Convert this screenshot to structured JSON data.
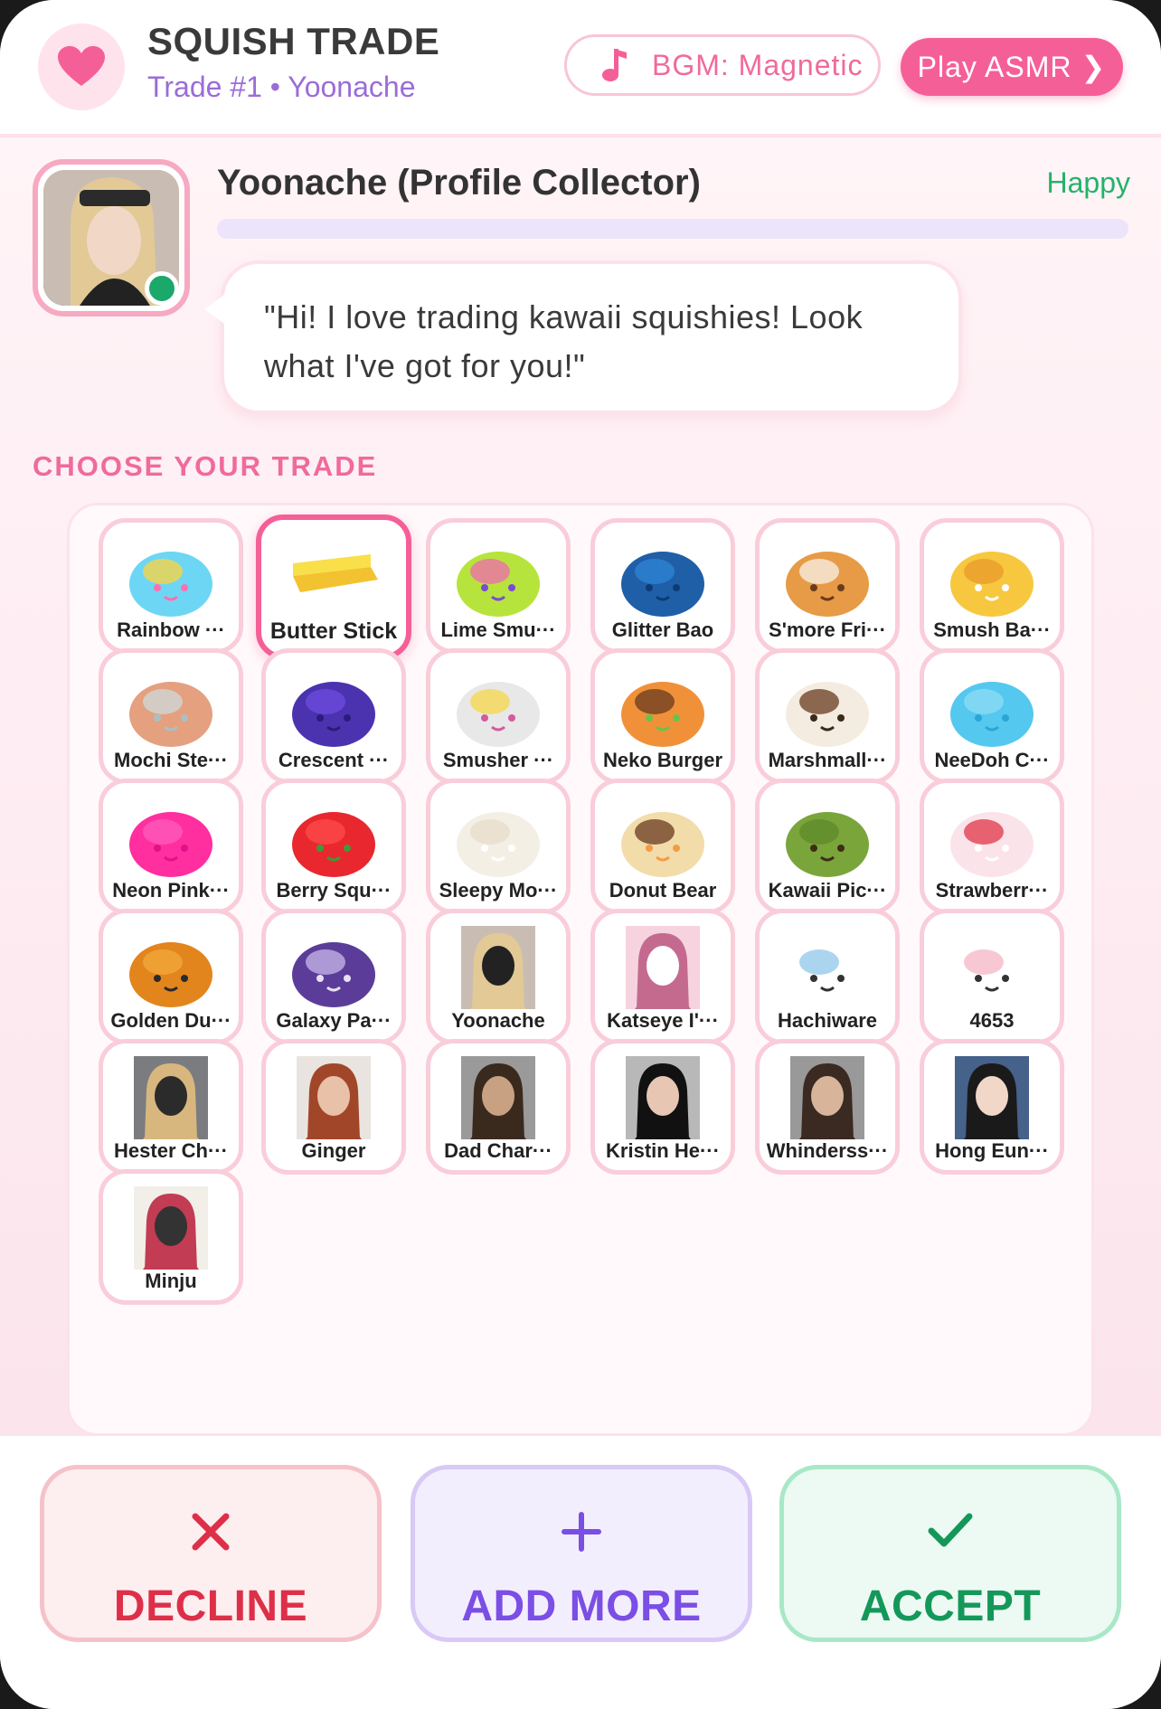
{
  "header": {
    "title": "SQUISH TRADE",
    "subtitle": "Trade #1 • Yoonache",
    "bgm_label": "BGM: Magnetic",
    "asmr_label": "Play ASMR",
    "asmr_chevron": "❯",
    "accent": "#f55f97"
  },
  "npc": {
    "name": "Yoonache (Profile Collector)",
    "mood": "Happy",
    "message": "\"Hi! I love trading kawaii squishies! Look what I've got for you!\"",
    "status": "online"
  },
  "choose_label": "CHOOSE YOUR TRADE",
  "items": [
    {
      "label": "Rainbow ···",
      "icon": "rainbow-bun-icon"
    },
    {
      "label": "Butter Stick",
      "icon": "butter-icon",
      "selected": true
    },
    {
      "label": "Lime Smu···",
      "icon": "lime-smusher-icon"
    },
    {
      "label": "Glitter Bao",
      "icon": "glitter-bao-icon"
    },
    {
      "label": "S'more Fri···",
      "icon": "smore-icon"
    },
    {
      "label": "Smush Ba···",
      "icon": "smush-banana-icon"
    },
    {
      "label": "Mochi Ste···",
      "icon": "mochi-steamer-icon"
    },
    {
      "label": "Crescent ···",
      "icon": "crescent-icon"
    },
    {
      "label": "Smusher ···",
      "icon": "smusher-icon"
    },
    {
      "label": "Neko Burger",
      "icon": "neko-burger-icon"
    },
    {
      "label": "Marshmall···",
      "icon": "marshmallow-icon"
    },
    {
      "label": "NeeDoh C···",
      "icon": "needoh-cube-icon"
    },
    {
      "label": "Neon Pink···",
      "icon": "neon-pink-icon"
    },
    {
      "label": "Berry Squ···",
      "icon": "strawberry-icon"
    },
    {
      "label": "Sleepy Mo···",
      "icon": "sleepy-mochi-icon"
    },
    {
      "label": "Donut Bear",
      "icon": "donut-bear-icon"
    },
    {
      "label": "Kawaii Pic···",
      "icon": "pickle-icon"
    },
    {
      "label": "Strawberr···",
      "icon": "strawberry-cake-icon"
    },
    {
      "label": "Golden Du···",
      "icon": "golden-dumpling-icon"
    },
    {
      "label": "Galaxy Pa···",
      "icon": "galaxy-panda-icon"
    },
    {
      "label": "Yoonache",
      "icon": "photo-yoonache-icon"
    },
    {
      "label": "Katseye I'···",
      "icon": "katseye-poster-icon"
    },
    {
      "label": "Hachiware",
      "icon": "hachiware-icon"
    },
    {
      "label": "4653",
      "icon": "chiikawa-icon"
    },
    {
      "label": "Hester Ch···",
      "icon": "photo-hester-icon"
    },
    {
      "label": "Ginger",
      "icon": "photo-ginger-icon"
    },
    {
      "label": "Dad Char···",
      "icon": "photo-dad-icon"
    },
    {
      "label": "Kristin He···",
      "icon": "photo-kristin-icon"
    },
    {
      "label": "Whinderss···",
      "icon": "photo-whinderss-icon"
    },
    {
      "label": "Hong Eun···",
      "icon": "photo-hong-icon"
    },
    {
      "label": "Minju",
      "icon": "minju-poster-icon"
    }
  ],
  "actions": {
    "decline": "DECLINE",
    "add_more": "ADD MORE",
    "accept": "ACCEPT"
  }
}
